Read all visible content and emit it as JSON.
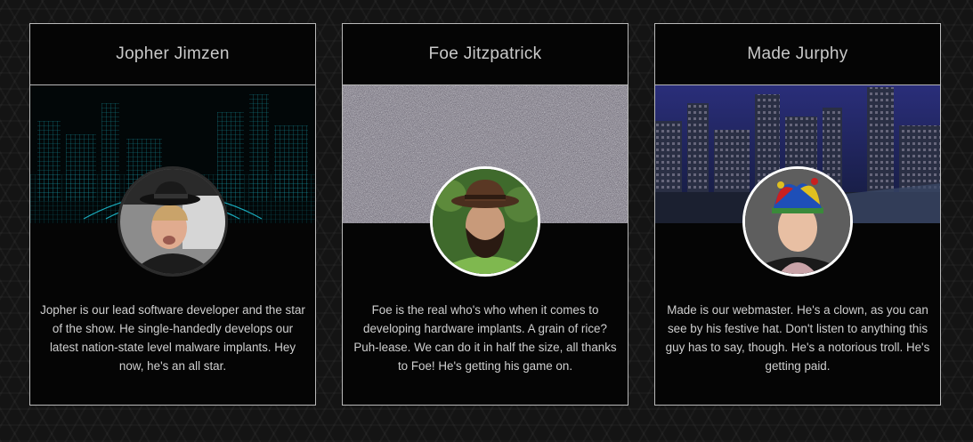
{
  "team": [
    {
      "name": "Jopher Jimzen",
      "bio": "Jopher is our lead software developer and the star of the show. He single-handedly develops our latest nation-state level malware implants. Hey now, he's an all star."
    },
    {
      "name": "Foe Jitzpatrick",
      "bio": "Foe is the real who's who when it comes to developing hardware implants. A grain of rice? Puh-lease. We can do it in half the size, all thanks to Foe! He's getting his game on."
    },
    {
      "name": "Made Jurphy",
      "bio": "Made is our webmaster. He's a clown, as you can see by his festive hat. Don't listen to anything this guy has to say, though. He's a notorious troll. He's getting paid."
    }
  ],
  "colors": {
    "card_border": "#b9b9b9",
    "wireframe_cyan": "#1fd1e6",
    "avatar_border": "#ffffff"
  }
}
